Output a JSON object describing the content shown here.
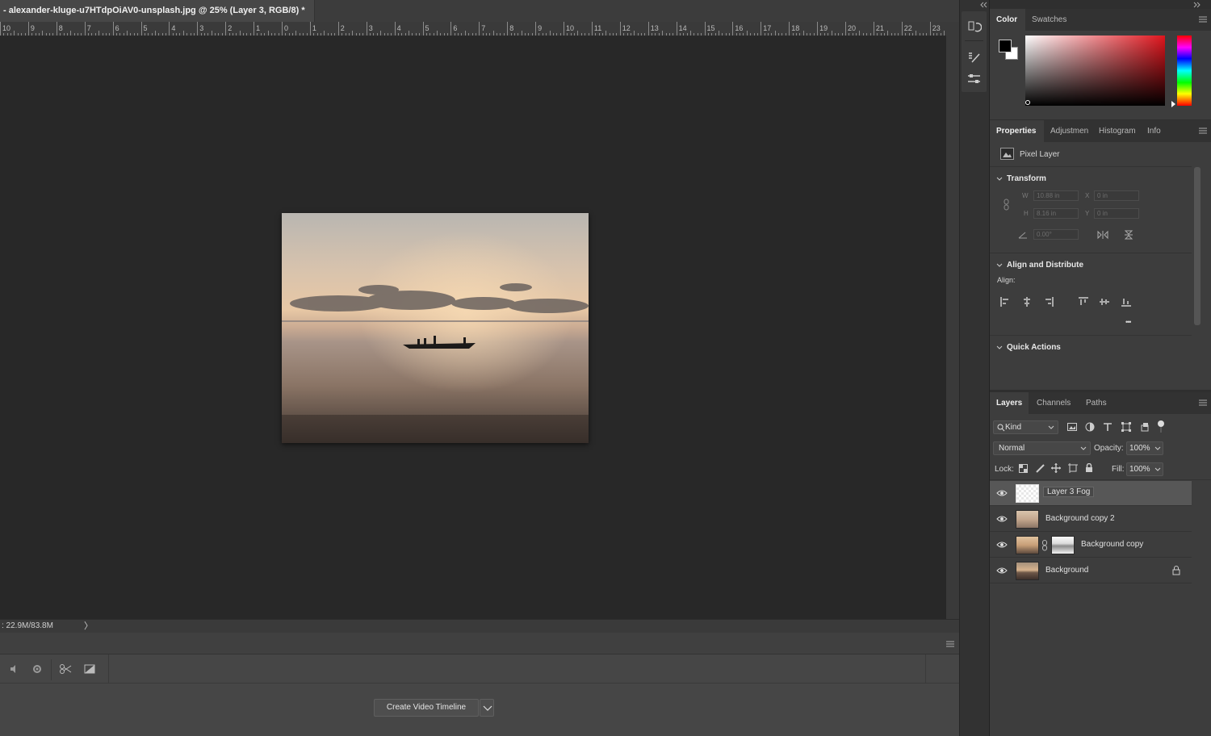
{
  "document": {
    "tab_title": "- alexander-kluge-u7HTdpOiAV0-unsplash.jpg @ 25% (Layer 3, RGB/8) *",
    "doc_size": ": 22.9M/83.8M",
    "status_chevron": "〉"
  },
  "ruler": {
    "labels": [
      "10",
      "9",
      "8",
      "7",
      "6",
      "5",
      "4",
      "3",
      "2",
      "1",
      "0",
      "1",
      "2",
      "3",
      "4",
      "5",
      "6",
      "7",
      "8",
      "9",
      "10",
      "11",
      "12",
      "13",
      "14",
      "15",
      "16",
      "17",
      "18",
      "19",
      "20",
      "21",
      "22",
      "23"
    ]
  },
  "timeline": {
    "create_button": "Create Video Timeline"
  },
  "color_panel": {
    "tabs": [
      "Color",
      "Swatches"
    ],
    "foreground": "#000000",
    "background": "#ffffff",
    "hue_color": "#e0151d"
  },
  "properties_panel": {
    "tabs": [
      "Properties",
      "Adjustmen",
      "Histogram",
      "Info"
    ],
    "layer_kind": "Pixel Layer",
    "transform": {
      "heading": "Transform",
      "w_label": "W",
      "w_value": "10.88 in",
      "h_label": "H",
      "h_value": "8.16 in",
      "x_label": "X",
      "x_value": "0 in",
      "y_label": "Y",
      "y_value": "0 in",
      "angle_value": "0.00°"
    },
    "align": {
      "heading": "Align and Distribute",
      "label": "Align:",
      "more": "•••"
    },
    "quick_actions": "Quick Actions"
  },
  "layers_panel": {
    "tabs": [
      "Layers",
      "Channels",
      "Paths"
    ],
    "filter_kind": "Kind",
    "blend_mode": "Normal",
    "opacity_label": "Opacity:",
    "opacity_value": "100%",
    "lock_label": "Lock:",
    "fill_label": "Fill:",
    "fill_value": "100%",
    "layers": [
      {
        "name": "Layer 3 Fog",
        "active": true
      },
      {
        "name": "Background copy 2",
        "active": false
      },
      {
        "name": "Background copy",
        "active": false
      },
      {
        "name": "Background",
        "active": false
      }
    ]
  }
}
